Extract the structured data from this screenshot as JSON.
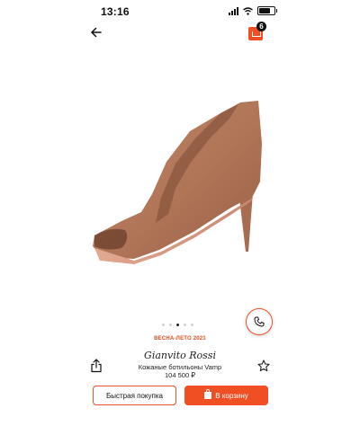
{
  "status_bar": {
    "time": "13:16",
    "battery_level": 0.85
  },
  "header": {
    "cart_count": "6"
  },
  "gallery": {
    "total_images": 5,
    "active_index": 3
  },
  "product": {
    "season": "ВЕСНА-ЛЕТО 2021",
    "brand": "Gianvito Rossi",
    "name": "Кожаные ботильоны Vamp",
    "price": "104 500 ₽"
  },
  "actions": {
    "quick_buy_label": "Быстрая покупка",
    "add_to_cart_label": "В корзину"
  },
  "colors": {
    "accent": "#f04e23",
    "shoe": "#b57b5e"
  },
  "icons": [
    "back-arrow-icon",
    "cart-icon",
    "phone-icon",
    "share-icon",
    "star-icon",
    "bag-icon"
  ]
}
